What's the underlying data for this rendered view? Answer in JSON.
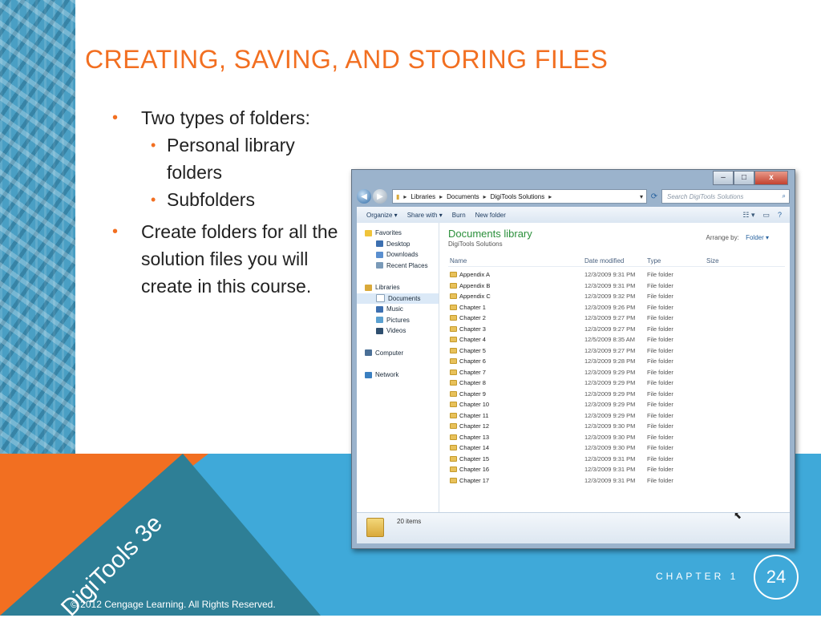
{
  "slide": {
    "title": "CREATING, SAVING, AND STORING FILES",
    "bullets": [
      {
        "text": "Two types of folders:",
        "sub": [
          "Personal library folders",
          "Subfolders"
        ]
      },
      {
        "text": "Create folders for all the solution files you will create in this course."
      }
    ],
    "brand": "DigiTools 3e",
    "copyright": "© 2012 Cengage Learning.  All Rights Reserved.",
    "chapter_label": "CHAPTER 1",
    "page_number": "24",
    "colors": {
      "accent_orange": "#f26f21",
      "band_blue": "#3fa9d9",
      "teal": "#2e7f96"
    }
  },
  "explorer": {
    "window_buttons": {
      "minimize": "–",
      "maximize": "□",
      "close": "x"
    },
    "breadcrumb": [
      "Libraries",
      "Documents",
      "DigiTools Solutions"
    ],
    "search_placeholder": "Search DigiTools Solutions",
    "toolbar": {
      "organize": "Organize ▾",
      "share": "Share with ▾",
      "burn": "Burn",
      "new_folder": "New folder"
    },
    "nav": {
      "favorites": {
        "label": "Favorites",
        "items": [
          "Desktop",
          "Downloads",
          "Recent Places"
        ]
      },
      "libraries": {
        "label": "Libraries",
        "items": [
          "Documents",
          "Music",
          "Pictures",
          "Videos"
        ]
      },
      "computer": "Computer",
      "network": "Network"
    },
    "library_title": "Documents library",
    "library_subtitle": "DigiTools Solutions",
    "arrange_label": "Arrange by:",
    "arrange_value": "Folder ▾",
    "columns": {
      "name": "Name",
      "date": "Date modified",
      "type": "Type",
      "size": "Size"
    },
    "files": [
      {
        "name": "Appendix A",
        "date": "12/3/2009 9:31 PM",
        "type": "File folder"
      },
      {
        "name": "Appendix B",
        "date": "12/3/2009 9:31 PM",
        "type": "File folder"
      },
      {
        "name": "Appendix C",
        "date": "12/3/2009 9:32 PM",
        "type": "File folder"
      },
      {
        "name": "Chapter 1",
        "date": "12/3/2009 9:26 PM",
        "type": "File folder"
      },
      {
        "name": "Chapter 2",
        "date": "12/3/2009 9:27 PM",
        "type": "File folder"
      },
      {
        "name": "Chapter 3",
        "date": "12/3/2009 9:27 PM",
        "type": "File folder"
      },
      {
        "name": "Chapter 4",
        "date": "12/5/2009 8:35 AM",
        "type": "File folder"
      },
      {
        "name": "Chapter 5",
        "date": "12/3/2009 9:27 PM",
        "type": "File folder"
      },
      {
        "name": "Chapter 6",
        "date": "12/3/2009 9:28 PM",
        "type": "File folder"
      },
      {
        "name": "Chapter 7",
        "date": "12/3/2009 9:29 PM",
        "type": "File folder"
      },
      {
        "name": "Chapter 8",
        "date": "12/3/2009 9:29 PM",
        "type": "File folder"
      },
      {
        "name": "Chapter 9",
        "date": "12/3/2009 9:29 PM",
        "type": "File folder"
      },
      {
        "name": "Chapter 10",
        "date": "12/3/2009 9:29 PM",
        "type": "File folder"
      },
      {
        "name": "Chapter 11",
        "date": "12/3/2009 9:29 PM",
        "type": "File folder"
      },
      {
        "name": "Chapter 12",
        "date": "12/3/2009 9:30 PM",
        "type": "File folder"
      },
      {
        "name": "Chapter 13",
        "date": "12/3/2009 9:30 PM",
        "type": "File folder"
      },
      {
        "name": "Chapter 14",
        "date": "12/3/2009 9:30 PM",
        "type": "File folder"
      },
      {
        "name": "Chapter 15",
        "date": "12/3/2009 9:31 PM",
        "type": "File folder"
      },
      {
        "name": "Chapter 16",
        "date": "12/3/2009 9:31 PM",
        "type": "File folder"
      },
      {
        "name": "Chapter 17",
        "date": "12/3/2009 9:31 PM",
        "type": "File folder"
      }
    ],
    "status_text": "20 items"
  }
}
